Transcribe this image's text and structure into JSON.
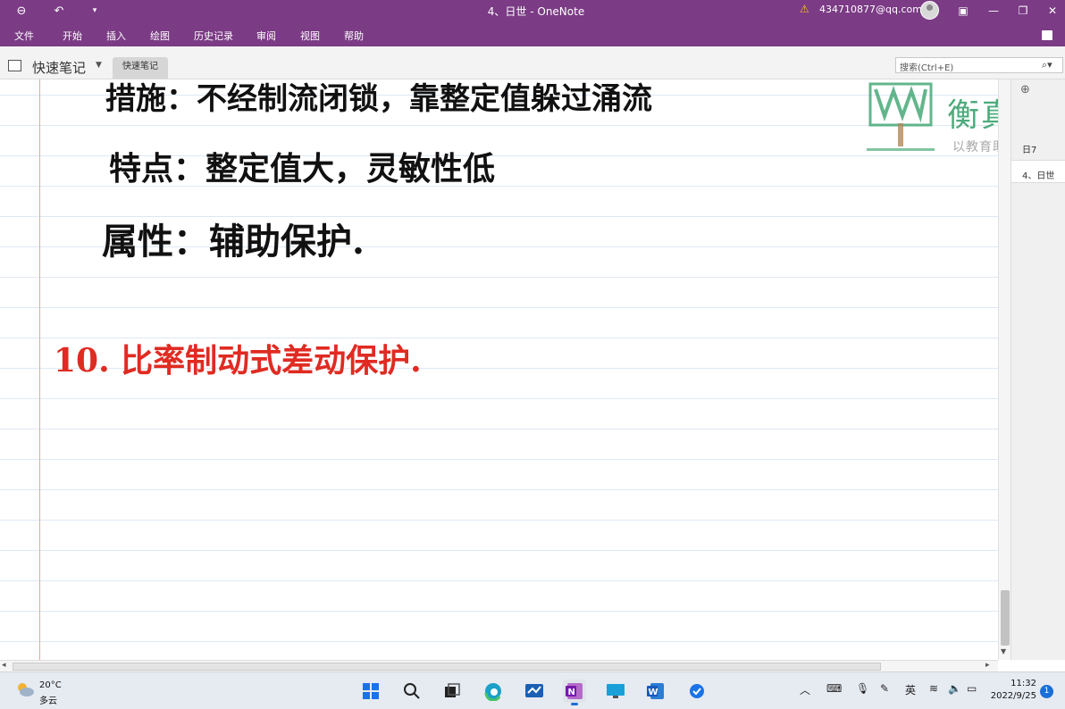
{
  "window": {
    "title": "4、日世  -  OneNote",
    "account": "434710877@qq.com"
  },
  "ribbon": {
    "tabs": [
      "文件",
      "开始",
      "插入",
      "绘图",
      "历史记录",
      "审阅",
      "视图",
      "帮助"
    ]
  },
  "notebook": {
    "name": "快速笔记",
    "section_tab": "快速笔记",
    "search_placeholder": "搜索(Ctrl+E)"
  },
  "page": {
    "handwriting": [
      {
        "text": "措施：不经制流闭锁，靠整定值躲过涌流",
        "color": "black"
      },
      {
        "text": "特点：整定值大，灵敏性低",
        "color": "black"
      },
      {
        "text": "属性：辅助保护.",
        "color": "black"
      },
      {
        "text": "10.  比率制动式差动保护.",
        "color": "red"
      }
    ]
  },
  "watermark": {
    "brand": "衡真教",
    "slogan": "以教育助力行业发"
  },
  "pages_pane": {
    "items": [
      "日7",
      "4、日世"
    ]
  },
  "taskbar": {
    "weather_temp": "20°C",
    "weather_desc": "多云",
    "ime": "英",
    "time": "11:32",
    "date": "2022/9/25",
    "notifications": "1"
  },
  "colors": {
    "onenote_purple": "#7b3b85",
    "ink_red": "#e02b22",
    "ink_black": "#111111",
    "watermark_green": "#2f9d66"
  }
}
